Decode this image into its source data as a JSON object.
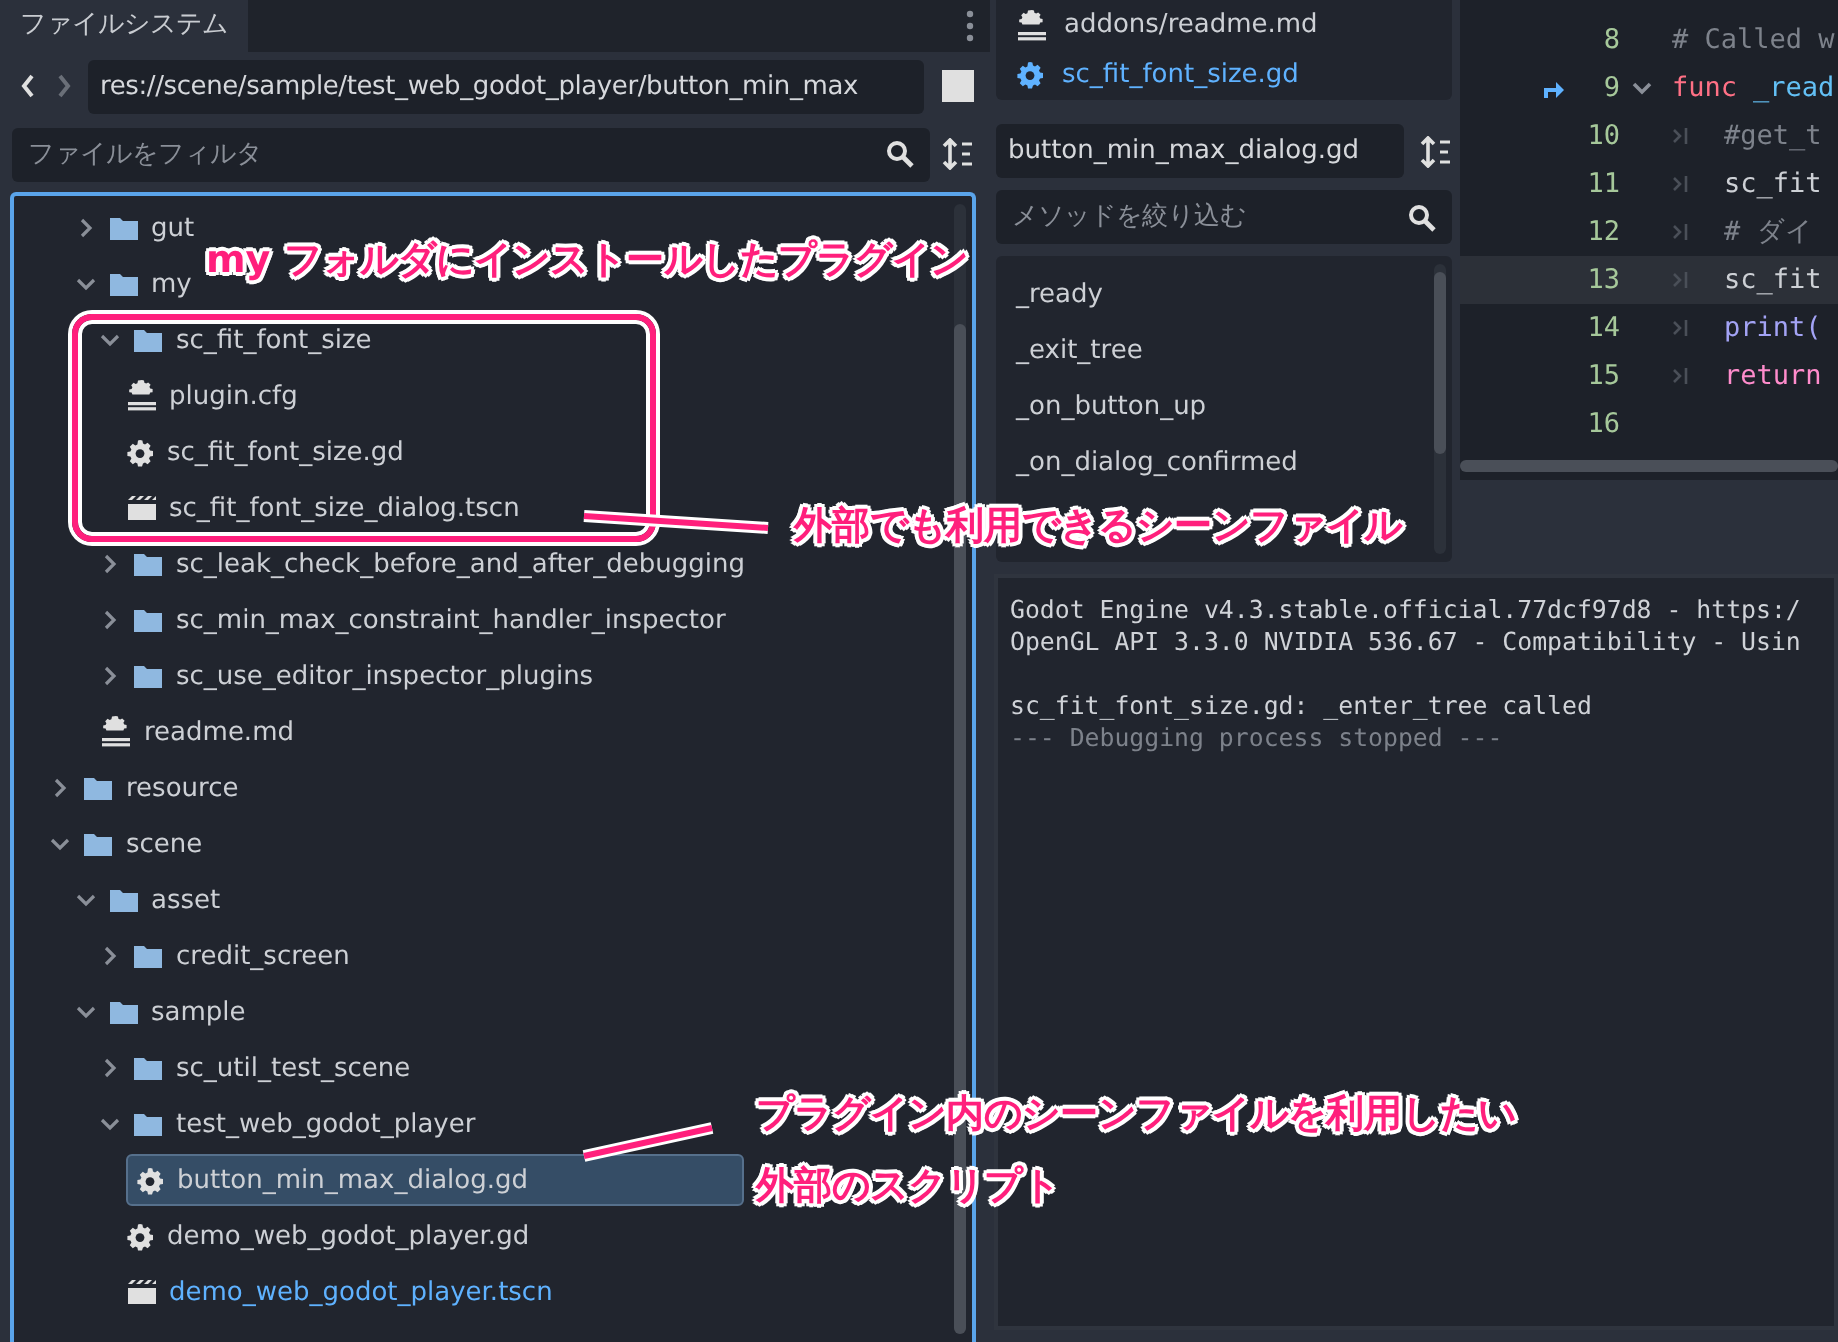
{
  "filesystem": {
    "tab": "ファイルシステム",
    "path": "res://scene/sample/test_web_godot_player/button_min_max",
    "filter_placeholder": "ファイルをフィルタ",
    "partial_folder_items": [
      {
        "name": "gut",
        "kind": "folder",
        "expanded": false,
        "selected": false,
        "current": false
      },
      {
        "name": "my",
        "kind": "folder",
        "expanded": true,
        "selected": false,
        "current": false,
        "children": [
          {
            "name": "sc_fit_font_size",
            "kind": "folder",
            "expanded": true,
            "selected": false,
            "current": false,
            "children": [
              {
                "name": "plugin.cfg",
                "kind": "text",
                "selected": false,
                "current": false
              },
              {
                "name": "sc_fit_font_size.gd",
                "kind": "script",
                "selected": false,
                "current": false
              },
              {
                "name": "sc_fit_font_size_dialog.tscn",
                "kind": "scene",
                "selected": false,
                "current": false
              }
            ]
          },
          {
            "name": "sc_leak_check_before_and_after_debugging",
            "kind": "folder",
            "expanded": false,
            "selected": false,
            "current": false
          },
          {
            "name": "sc_min_max_constraint_handler_inspector",
            "kind": "folder",
            "expanded": false,
            "selected": false,
            "current": false
          },
          {
            "name": "sc_use_editor_inspector_plugins",
            "kind": "folder",
            "expanded": false,
            "selected": false,
            "current": false
          },
          {
            "name": "readme.md",
            "kind": "text",
            "selected": false,
            "current": false
          }
        ]
      }
    ],
    "tree": [
      {
        "name": "resource",
        "kind": "folder",
        "expanded": false,
        "selected": false,
        "current": false
      },
      {
        "name": "scene",
        "kind": "folder",
        "expanded": true,
        "selected": false,
        "current": false,
        "children": [
          {
            "name": "asset",
            "kind": "folder",
            "expanded": true,
            "selected": false,
            "current": false,
            "children": [
              {
                "name": "credit_screen",
                "kind": "folder",
                "expanded": false,
                "selected": false,
                "current": false
              }
            ]
          },
          {
            "name": "sample",
            "kind": "folder",
            "expanded": true,
            "selected": false,
            "current": false,
            "children": [
              {
                "name": "sc_util_test_scene",
                "kind": "folder",
                "expanded": false,
                "selected": false,
                "current": false
              },
              {
                "name": "test_web_godot_player",
                "kind": "folder",
                "expanded": true,
                "selected": false,
                "current": false,
                "children": [
                  {
                    "name": "button_min_max_dialog.gd",
                    "kind": "script",
                    "selected": true,
                    "current": false
                  },
                  {
                    "name": "demo_web_godot_player.gd",
                    "kind": "script",
                    "selected": false,
                    "current": false
                  },
                  {
                    "name": "demo_web_godot_player.tscn",
                    "kind": "scene",
                    "selected": false,
                    "current": true
                  }
                ]
              }
            ]
          }
        ]
      }
    ]
  },
  "script_panel": {
    "open_scripts": [
      {
        "name": "addons/readme.md",
        "kind": "text",
        "current": false
      },
      {
        "name": "sc_fit_font_size.gd",
        "kind": "script",
        "current": true
      }
    ],
    "script_name": "button_min_max_dialog.gd",
    "method_filter_placeholder": "メソッドを絞り込む",
    "methods": [
      "_ready",
      "_exit_tree",
      "_on_button_up",
      "_on_dialog_confirmed"
    ]
  },
  "code": {
    "lines": [
      {
        "number": "8",
        "indented": false,
        "highlighted": false,
        "marker": false,
        "foldable": false,
        "tokens": [
          {
            "kind": "comment",
            "text": "# Called w"
          }
        ]
      },
      {
        "number": "9",
        "indented": false,
        "highlighted": false,
        "marker": true,
        "foldable": true,
        "tokens": [
          {
            "kind": "keyword",
            "text": "func"
          },
          {
            "kind": "function",
            "text": "_read"
          }
        ]
      },
      {
        "number": "10",
        "indented": true,
        "highlighted": false,
        "marker": false,
        "foldable": false,
        "tokens": [
          {
            "kind": "comment",
            "text": "#get_t"
          }
        ]
      },
      {
        "number": "11",
        "indented": true,
        "highlighted": false,
        "marker": false,
        "foldable": false,
        "tokens": [
          {
            "kind": "plain",
            "text": "sc_fit"
          }
        ]
      },
      {
        "number": "12",
        "indented": true,
        "highlighted": false,
        "marker": false,
        "foldable": false,
        "tokens": [
          {
            "kind": "comment",
            "text": "# ダイ"
          }
        ]
      },
      {
        "number": "13",
        "indented": true,
        "highlighted": true,
        "marker": false,
        "foldable": false,
        "tokens": [
          {
            "kind": "plain",
            "text": "sc_fit"
          }
        ]
      },
      {
        "number": "14",
        "indented": true,
        "highlighted": false,
        "marker": false,
        "foldable": false,
        "tokens": [
          {
            "kind": "builtin",
            "text": "print("
          }
        ]
      },
      {
        "number": "15",
        "indented": true,
        "highlighted": false,
        "marker": false,
        "foldable": false,
        "tokens": [
          {
            "kind": "control",
            "text": "return"
          }
        ]
      },
      {
        "number": "16",
        "indented": false,
        "highlighted": false,
        "marker": false,
        "foldable": false
      }
    ]
  },
  "output": {
    "lines": [
      {
        "kind": "normal",
        "gap_before": false,
        "text": "Godot Engine v4.3.stable.official.77dcf97d8 - https:/"
      },
      {
        "kind": "normal",
        "gap_before": false,
        "text": "OpenGL API 3.3.0 NVIDIA 536.67 - Compatibility - Usin"
      },
      {
        "kind": "normal",
        "gap_before": true,
        "text": "sc_fit_font_size.gd: _enter_tree called"
      },
      {
        "kind": "dim",
        "gap_before": false,
        "text": "--- Debugging process stopped ---"
      }
    ]
  },
  "annotations": [
    {
      "kind": "label",
      "text": "my フォルダにインストールしたプラグイン"
    },
    {
      "kind": "box"
    },
    {
      "kind": "leader"
    },
    {
      "kind": "label",
      "text": "外部でも利用できるシーンファイル"
    },
    {
      "kind": "leader"
    },
    {
      "kind": "label",
      "text": "プラグイン内のシーンファイルを利用したい"
    },
    {
      "kind": "label",
      "text": "外部のスクリプト"
    }
  ]
}
